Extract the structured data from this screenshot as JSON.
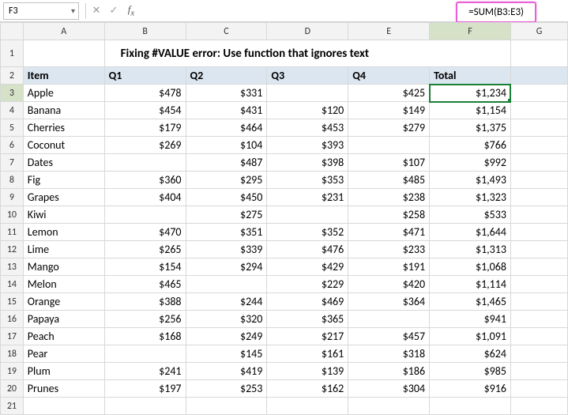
{
  "formula_bar": {
    "cell_ref": "F3",
    "input_value": "",
    "callout": "=SUM(B3:E3)"
  },
  "col_letters": [
    "A",
    "B",
    "C",
    "D",
    "E",
    "F",
    "G"
  ],
  "title": "Fixing #VALUE error: Use function that ignores text",
  "headers": {
    "A": "Item",
    "B": "Q1",
    "C": "Q2",
    "D": "Q3",
    "E": "Q4",
    "F": "Total"
  },
  "active": {
    "col": "F",
    "row": 3
  },
  "rows": [
    {
      "n": 3,
      "item": "Apple",
      "q1": "$478",
      "q2": "$331",
      "q3": "",
      "q4": "$425",
      "total": "$1,234"
    },
    {
      "n": 4,
      "item": "Banana",
      "q1": "$454",
      "q2": "$431",
      "q3": "$120",
      "q4": "$149",
      "total": "$1,154"
    },
    {
      "n": 5,
      "item": "Cherries",
      "q1": "$179",
      "q2": "$464",
      "q3": "$453",
      "q4": "$279",
      "total": "$1,375"
    },
    {
      "n": 6,
      "item": "Coconut",
      "q1": "$269",
      "q2": "$104",
      "q3": "$393",
      "q4": "",
      "total": "$766"
    },
    {
      "n": 7,
      "item": "Dates",
      "q1": "",
      "q2": "$487",
      "q3": "$398",
      "q4": "$107",
      "total": "$992"
    },
    {
      "n": 8,
      "item": "Fig",
      "q1": "$360",
      "q2": "$295",
      "q3": "$353",
      "q4": "$485",
      "total": "$1,493"
    },
    {
      "n": 9,
      "item": "Grapes",
      "q1": "$404",
      "q2": "$450",
      "q3": "$231",
      "q4": "$238",
      "total": "$1,323"
    },
    {
      "n": 10,
      "item": "Kiwi",
      "q1": "",
      "q2": "$275",
      "q3": "",
      "q4": "$258",
      "total": "$533"
    },
    {
      "n": 11,
      "item": "Lemon",
      "q1": "$470",
      "q2": "$351",
      "q3": "$352",
      "q4": "$471",
      "total": "$1,644"
    },
    {
      "n": 12,
      "item": "Lime",
      "q1": "$265",
      "q2": "$339",
      "q3": "$476",
      "q4": "$233",
      "total": "$1,313"
    },
    {
      "n": 13,
      "item": "Mango",
      "q1": "$154",
      "q2": "$294",
      "q3": "$429",
      "q4": "$191",
      "total": "$1,068"
    },
    {
      "n": 14,
      "item": "Melon",
      "q1": "$465",
      "q2": "",
      "q3": "$229",
      "q4": "$420",
      "total": "$1,114"
    },
    {
      "n": 15,
      "item": "Orange",
      "q1": "$388",
      "q2": "$244",
      "q3": "$469",
      "q4": "$364",
      "total": "$1,465"
    },
    {
      "n": 16,
      "item": "Papaya",
      "q1": "$256",
      "q2": "$320",
      "q3": "$365",
      "q4": "",
      "total": "$941"
    },
    {
      "n": 17,
      "item": "Peach",
      "q1": "$168",
      "q2": "$249",
      "q3": "$217",
      "q4": "$457",
      "total": "$1,091"
    },
    {
      "n": 18,
      "item": "Pear",
      "q1": "",
      "q2": "$145",
      "q3": "$161",
      "q4": "$318",
      "total": "$624"
    },
    {
      "n": 19,
      "item": "Plum",
      "q1": "$241",
      "q2": "$419",
      "q3": "$139",
      "q4": "$186",
      "total": "$985"
    },
    {
      "n": 20,
      "item": "Prunes",
      "q1": "$197",
      "q2": "$253",
      "q3": "$162",
      "q4": "$304",
      "total": "$916"
    }
  ],
  "empty_rows": [
    21
  ]
}
